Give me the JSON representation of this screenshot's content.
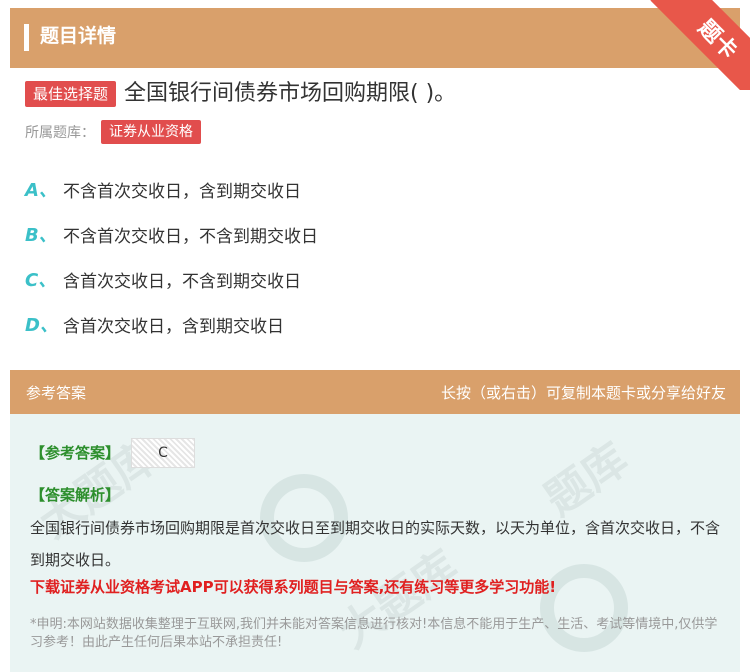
{
  "header": {
    "title": "题目详情",
    "corner_label": "题卡"
  },
  "question": {
    "type_tag": "最佳选择题",
    "text": "全国银行间债券市场回购期限( )。",
    "bank_label": "所属题库：",
    "bank_tag": "证券从业资格"
  },
  "options": [
    {
      "letter": "A、",
      "text": "不含首次交收日，含到期交收日"
    },
    {
      "letter": "B、",
      "text": "不含首次交收日，不含到期交收日"
    },
    {
      "letter": "C、",
      "text": "含首次交收日，不含到期交收日"
    },
    {
      "letter": "D、",
      "text": "含首次交收日，含到期交收日"
    }
  ],
  "answer_section": {
    "title": "参考答案",
    "share_hint": "长按（或右击）可复制本题卡或分享给好友",
    "ref_answer_label": "【参考答案】",
    "ref_answer_value": "C",
    "analysis_label": "【答案解析】",
    "analysis_text": "全国银行间债券市场回购期限是首次交收日至到期交收日的实际天数，以天为单位，含首次交收日，不含到期交收日。",
    "promo": "下载证券从业资格考试APP可以获得系列题目与答案,还有练习等更多学习功能!",
    "disclaimer": "*申明:本网站数据收集整理于互联网,我们并未能对答案信息进行核对!本信息不能用于生产、生活、考试等情境中,仅供学习参考！由此产生任何后果本站不承担责任!"
  },
  "colors": {
    "accent": "#d9a06b",
    "tag": "#e14d4d",
    "option_letter": "#3bc0c8",
    "promo": "#e02020",
    "answer_bg": "#eaf4f3"
  }
}
